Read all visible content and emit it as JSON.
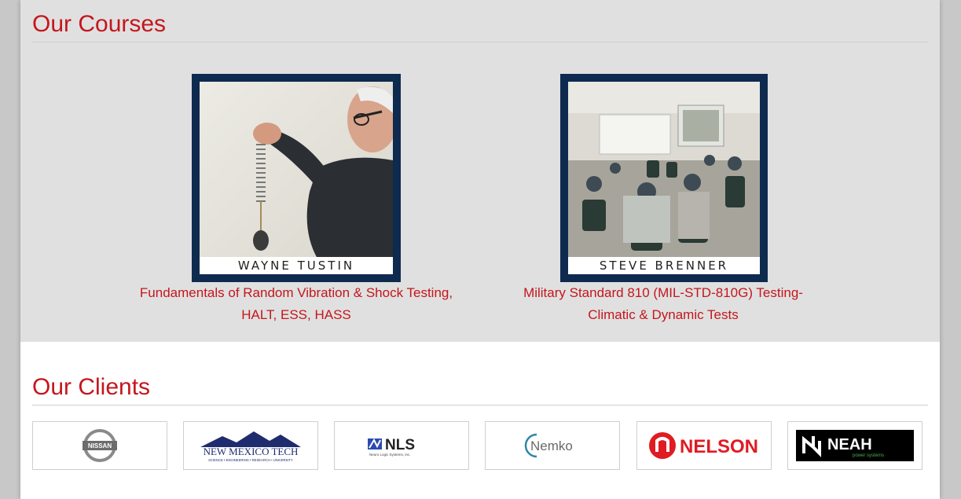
{
  "courses_section": {
    "title": "Our Courses",
    "courses": [
      {
        "instructor": "WAYNE TUSTIN",
        "link_line1": "Fundamentals of Random Vibration & Shock Testing,",
        "link_line2": "HALT, ESS, HASS"
      },
      {
        "instructor": "STEVE BRENNER",
        "link_line1": "Military Standard 810 (MIL-STD-810G) Testing-",
        "link_line2": "Climatic & Dynamic Tests"
      }
    ]
  },
  "clients_section": {
    "title": "Our Clients",
    "clients": [
      {
        "logo_text": "NISSAN",
        "icon": "nissan-logo"
      },
      {
        "logo_text": "NEW MEXICO TECH",
        "sub_text": "SCIENCE • ENGINEERING • RESEARCH • UNIVERSITY",
        "icon": "nmt-logo"
      },
      {
        "logo_text": "NLS",
        "sub_text": "Neuro Logic Systems, Inc.",
        "icon": "nls-logo"
      },
      {
        "logo_text": "Nemko",
        "icon": "nemko-logo"
      },
      {
        "logo_text": "NELSON",
        "icon": "nelson-logo"
      },
      {
        "logo_text": "NEAH",
        "sub_text": "power systems",
        "icon": "neah-logo"
      }
    ]
  },
  "colors": {
    "accent_red": "#c4161c",
    "frame_navy": "#0f2a4f",
    "section_grey": "#e0e0e0"
  }
}
